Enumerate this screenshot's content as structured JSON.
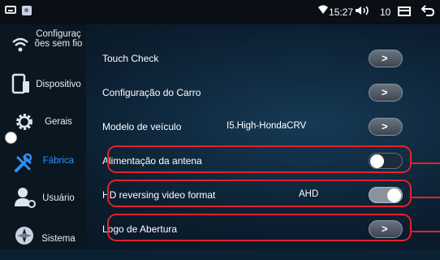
{
  "status_bar": {
    "time": "15:27",
    "volume": "10",
    "icons": [
      "window-icon",
      "photo-icon",
      "wifi-icon",
      "volume-icon",
      "recent-apps-icon",
      "back-icon"
    ]
  },
  "sidebar": {
    "items": [
      {
        "label": "Configuraç ões sem fio",
        "icon": "wifi-icon",
        "active": false
      },
      {
        "label": "Dispositivo",
        "icon": "device-icon",
        "active": false
      },
      {
        "label": "Gerais",
        "icon": "gear-icon",
        "active": false
      },
      {
        "label": "Fábrica",
        "icon": "tools-icon",
        "active": true
      },
      {
        "label": "Usuário",
        "icon": "user-icon",
        "active": false
      },
      {
        "label": "Sistema",
        "icon": "system-icon",
        "active": false
      }
    ]
  },
  "settings": {
    "rows": [
      {
        "label": "Touch Check",
        "control": "arrow",
        "value": ""
      },
      {
        "label": "Configuração do Carro",
        "control": "arrow",
        "value": ""
      },
      {
        "label": "Modelo de veículo",
        "control": "arrow",
        "value": "I5.High-HondaCRV"
      },
      {
        "label": "Alimentação da antena",
        "control": "toggle",
        "state": "off",
        "value": ""
      },
      {
        "label": "HD reversing video format",
        "control": "toggle",
        "state": "on",
        "value": "AHD"
      },
      {
        "label": "Logo de Abertura",
        "control": "arrow",
        "value": ""
      }
    ]
  },
  "colors": {
    "accent": "#2e8fff",
    "highlight": "#e2222d",
    "background": "#0c2033"
  }
}
